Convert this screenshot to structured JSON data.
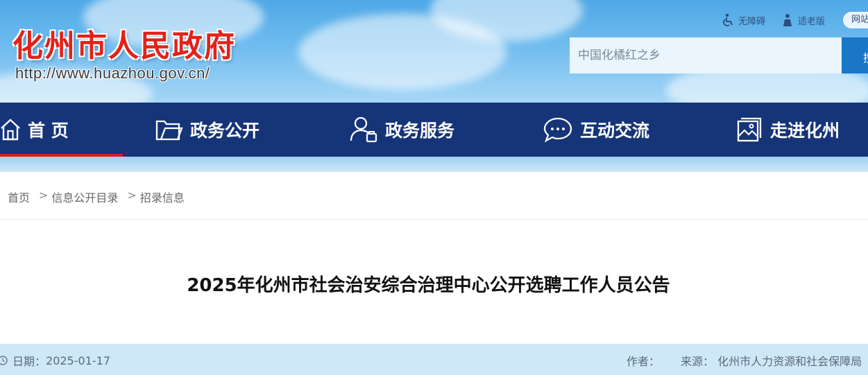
{
  "header": {
    "site_title": "化州市人民政府",
    "site_url": "http://www.huazhou.gov.cn/",
    "accessibility_label": "无障碍",
    "elder_label": "适老版",
    "network_label": "网站",
    "search": {
      "placeholder": "中国化橘红之乡",
      "button_label": "搜"
    }
  },
  "nav": {
    "items": [
      {
        "label": "首 页",
        "icon": "home-icon"
      },
      {
        "label": "政务公开",
        "icon": "folder-icon"
      },
      {
        "label": "政务服务",
        "icon": "user-service-icon"
      },
      {
        "label": "互动交流",
        "icon": "chat-icon"
      },
      {
        "label": "走进化州",
        "icon": "picture-icon"
      }
    ]
  },
  "breadcrumb": [
    "首页",
    "信息公开目录",
    "招录信息"
  ],
  "article": {
    "title": "2025年化州市社会治安综合治理中心公开选聘工作人员公告",
    "date_label": "日期：",
    "date": "2025-01-17",
    "author_label": "作者：",
    "source_label": "来源：",
    "source": "化州市人力资源和社会保障局"
  },
  "colors": {
    "nav_bg": "#163478",
    "nav_active": "#d41e1e",
    "title_red": "#e2221a",
    "meta_bg": "#cfe8f8"
  }
}
